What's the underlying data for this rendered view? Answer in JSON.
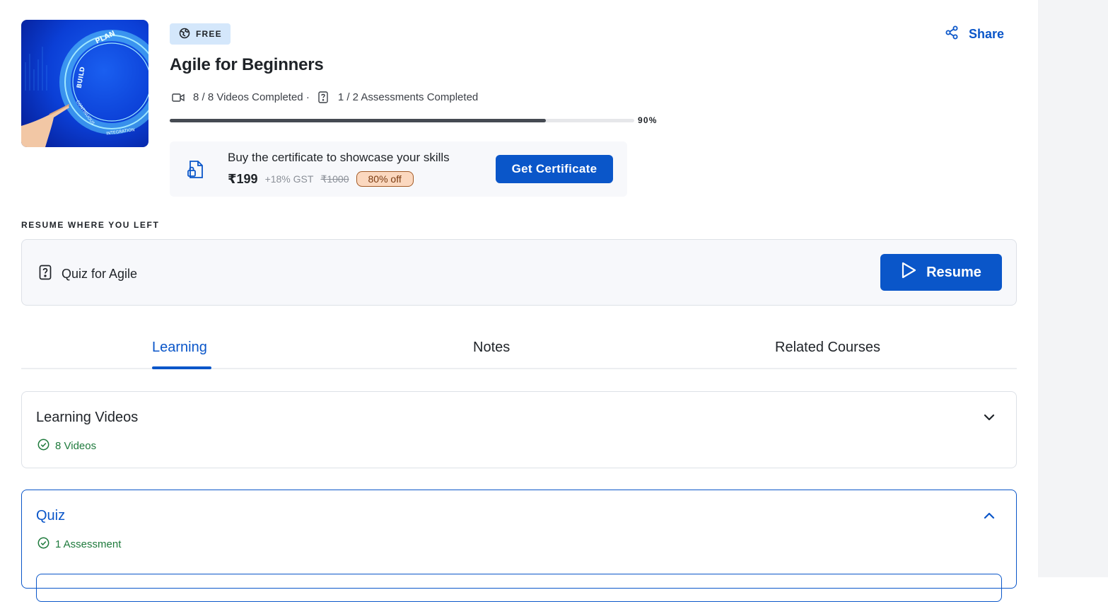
{
  "course": {
    "badge": "FREE",
    "title": "Agile for Beginners",
    "thumbnail_words": [
      "PLAN",
      "BUILD",
      "CONTINUOUS",
      "INTEGRATION"
    ],
    "stats": {
      "videos": "8 / 8 Videos Completed ·",
      "assessments": "1 / 2 Assessments Completed"
    },
    "progress": {
      "percent": 90,
      "label": "90%"
    }
  },
  "share": {
    "label": "Share"
  },
  "certificate": {
    "prompt": "Buy the certificate to showcase your skills",
    "price": "₹199",
    "gst": "+18% GST",
    "original_price": "₹1000",
    "discount": "80% off",
    "button": "Get Certificate"
  },
  "resume": {
    "heading": "RESUME WHERE YOU LEFT",
    "item": "Quiz for Agile",
    "button": "Resume"
  },
  "tabs": [
    {
      "label": "Learning",
      "active": true
    },
    {
      "label": "Notes",
      "active": false
    },
    {
      "label": "Related Courses",
      "active": false
    }
  ],
  "sections": [
    {
      "title": "Learning Videos",
      "meta": "8 Videos",
      "expanded": false
    },
    {
      "title": "Quiz",
      "meta": "1 Assessment",
      "expanded": true
    }
  ],
  "colors": {
    "accent": "#0a56c9",
    "success": "#1e7a3c",
    "badge_bg": "#d4e7fb",
    "discount_bg": "#fbd8bf"
  }
}
